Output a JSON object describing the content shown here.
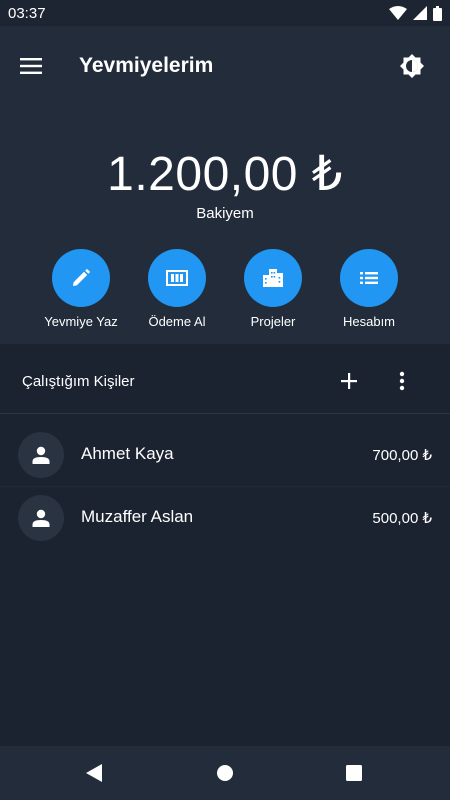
{
  "status_bar": {
    "time": "03:37"
  },
  "app_bar": {
    "title": "Yevmiyelerim"
  },
  "balance": {
    "amount": "1.200,00 ₺",
    "label": "Bakiyem"
  },
  "actions": [
    {
      "label": "Yevmiye Yaz",
      "icon": "pencil-icon"
    },
    {
      "label": "Ödeme Al",
      "icon": "cash-icon"
    },
    {
      "label": "Projeler",
      "icon": "building-icon"
    },
    {
      "label": "Hesabım",
      "icon": "list-icon"
    }
  ],
  "people_section": {
    "title": "Çalıştığım Kişiler",
    "people": [
      {
        "name": "Ahmet Kaya",
        "amount": "700,00 ₺"
      },
      {
        "name": "Muzaffer Aslan",
        "amount": "500,00 ₺"
      }
    ]
  },
  "colors": {
    "accent": "#2196f3",
    "header_bg": "#232c3a",
    "body_bg": "#1b2230"
  }
}
